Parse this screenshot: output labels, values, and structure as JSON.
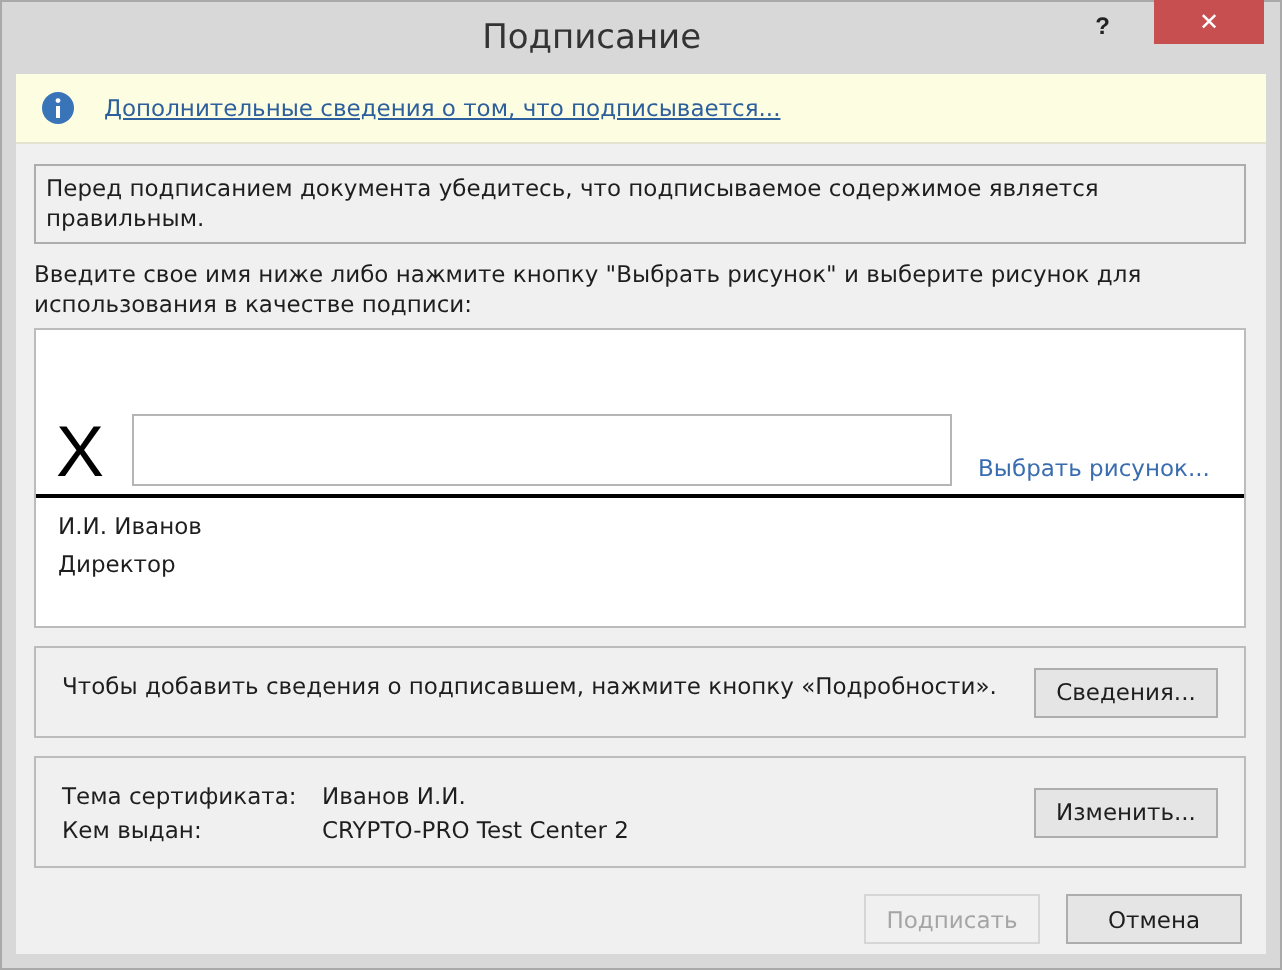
{
  "window": {
    "title": "Подписание",
    "help": "?",
    "close": "✕"
  },
  "info_bar": {
    "link": "Дополнительные сведения о том, что подписывается..."
  },
  "notice": "Перед подписанием документа убедитесь, что подписываемое содержимое является правильным.",
  "instruction": "Введите свое имя ниже либо нажмите кнопку \"Выбрать рисунок\" и выберите рисунок для использования в качестве подписи:",
  "signature": {
    "mark": "X",
    "pick_image": "Выбрать рисунок...",
    "signer_lines": [
      "И.И. Иванов",
      "Директор"
    ]
  },
  "details": {
    "text": "Чтобы добавить сведения о подписавшем, нажмите кнопку «Подробности».",
    "button": "Сведения..."
  },
  "certificate": {
    "fields": [
      {
        "label": "Тема сертификата:",
        "value": "Иванов И.И."
      },
      {
        "label": "Кем выдан:",
        "value": "CRYPTO-PRO Test Center 2"
      }
    ],
    "button": "Изменить..."
  },
  "buttons": [
    {
      "label": "Подписать",
      "disabled": true
    },
    {
      "label": "Отмена",
      "disabled": false
    }
  ]
}
